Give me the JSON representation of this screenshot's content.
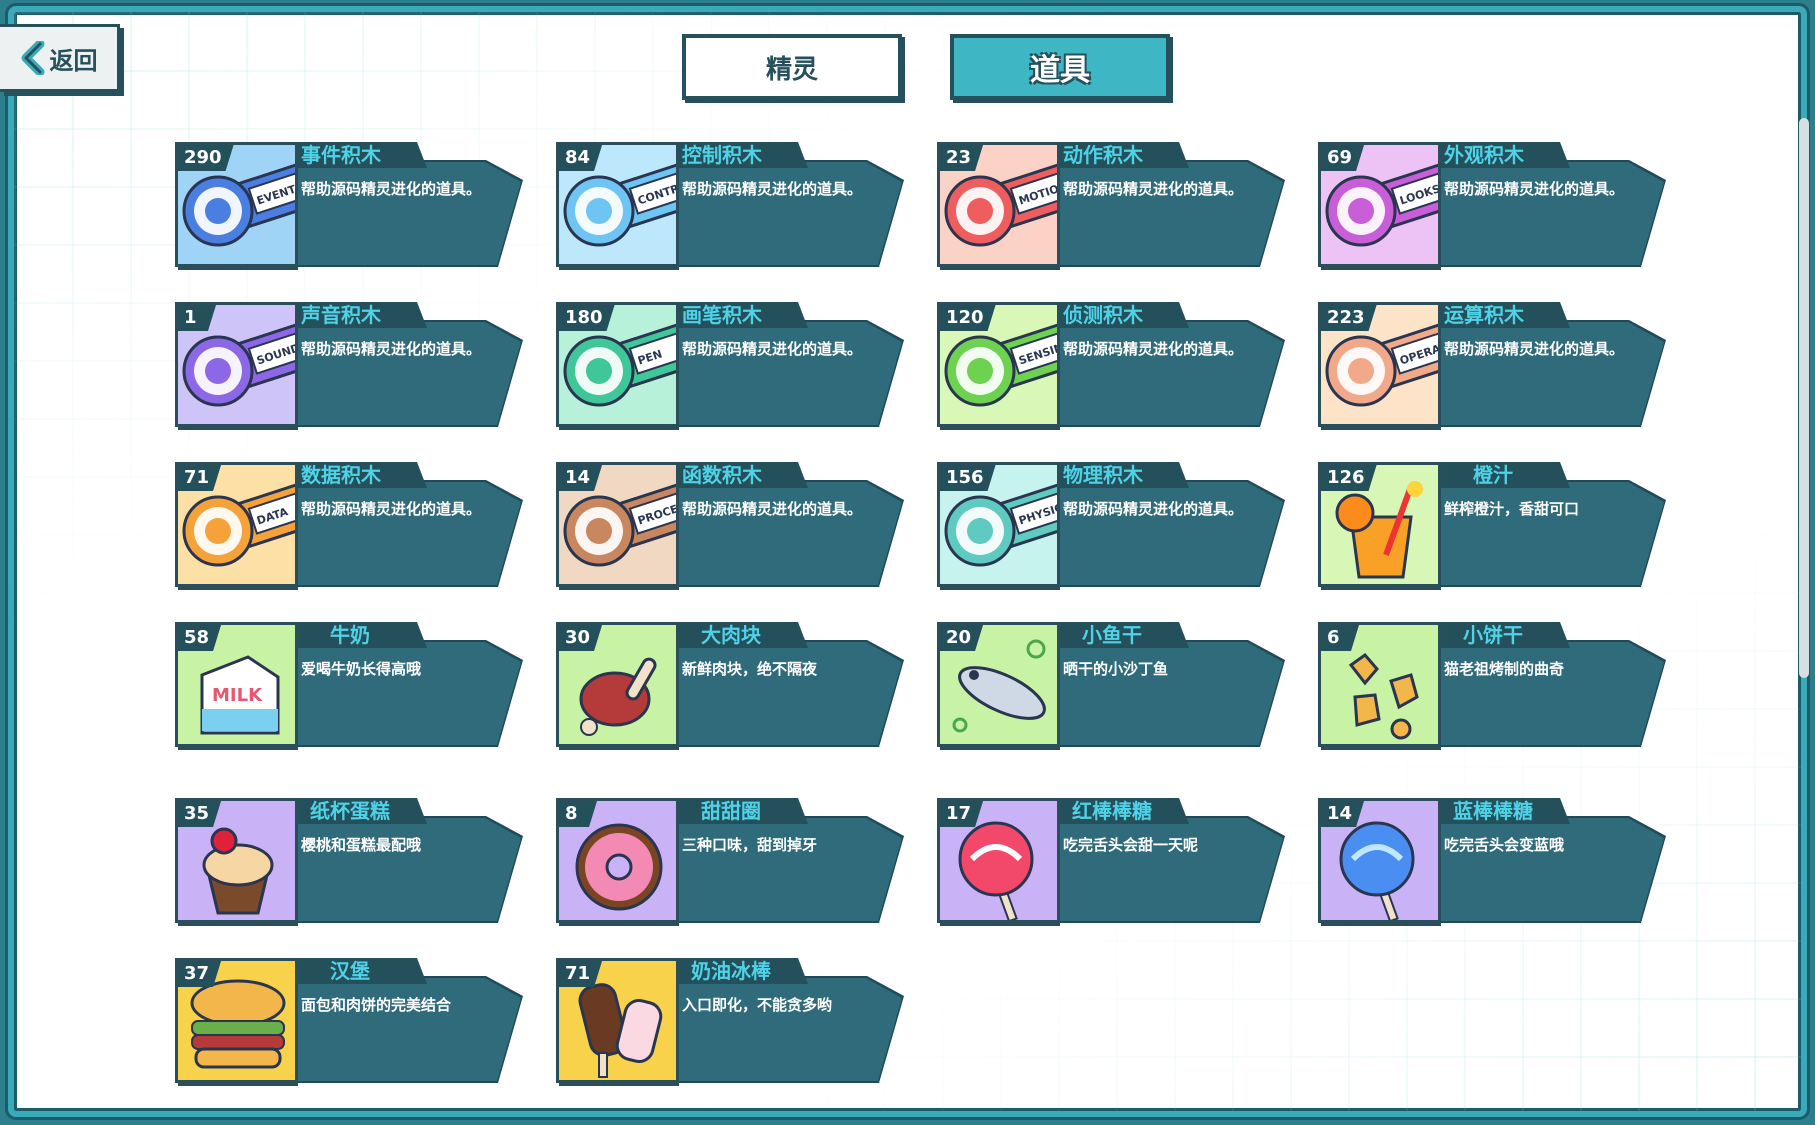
{
  "nav": {
    "back_label": "返回"
  },
  "tabs": {
    "sprite": "精灵",
    "items": "道具"
  },
  "colors": {
    "accent": "#3fb6c3",
    "panel": "#2f6b7a",
    "outline": "#26505b",
    "title_text": "#4fd2e6"
  },
  "items": [
    {
      "count": "290",
      "name": "事件积木",
      "desc": "帮助源码精灵进化的道具。",
      "bg": "#9fd4f6",
      "key": "#4a7ee0",
      "icon": "toggle-icon",
      "tag": "EVENTS"
    },
    {
      "count": "84",
      "name": "控制积木",
      "desc": "帮助源码精灵进化的道具。",
      "bg": "#bde7fb",
      "key": "#6ec4f2",
      "icon": "gamepad-icon",
      "tag": "CONTRO"
    },
    {
      "count": "23",
      "name": "动作积木",
      "desc": "帮助源码精灵进化的道具。",
      "bg": "#fcd2c6",
      "key": "#ef5e5e",
      "icon": "ghost-icon",
      "tag": "MOTION"
    },
    {
      "count": "69",
      "name": "外观积木",
      "desc": "帮助源码精灵进化的道具。",
      "bg": "#ecc3f4",
      "key": "#c85fd8",
      "icon": "shirt-icon",
      "tag": "LOOKS"
    },
    {
      "count": "1",
      "name": "声音积木",
      "desc": "帮助源码精灵进化的道具。",
      "bg": "#cfc4f8",
      "key": "#8c68e6",
      "icon": "microphone-icon",
      "tag": "SOUND"
    },
    {
      "count": "180",
      "name": "画笔积木",
      "desc": "帮助源码精灵进化的道具。",
      "bg": "#b7f1da",
      "key": "#3fc79a",
      "icon": "pen-icon",
      "tag": "PEN"
    },
    {
      "count": "120",
      "name": "侦测积木",
      "desc": "帮助源码精灵进化的道具。",
      "bg": "#d9f7b7",
      "key": "#6cd24f",
      "icon": "target-icon",
      "tag": "SENSING"
    },
    {
      "count": "223",
      "name": "运算积木",
      "desc": "帮助源码精灵进化的道具。",
      "bg": "#fde3c8",
      "key": "#f2a98a",
      "icon": "calculator-icon",
      "tag": "OPERATO"
    },
    {
      "count": "71",
      "name": "数据积木",
      "desc": "帮助源码精灵进化的道具。",
      "bg": "#fde0a6",
      "key": "#f6a23a",
      "icon": "bar-chart-icon",
      "tag": "DATA"
    },
    {
      "count": "14",
      "name": "函数积木",
      "desc": "帮助源码精灵进化的道具。",
      "bg": "#f1d8c3",
      "key": "#c9875f",
      "icon": "function-icon",
      "tag": "PROCED"
    },
    {
      "count": "156",
      "name": "物理积木",
      "desc": "帮助源码精灵进化的道具。",
      "bg": "#c7f3ee",
      "key": "#5fcbc0",
      "icon": "magnet-icon",
      "tag": "PHYSICS"
    },
    {
      "count": "126",
      "name": "橙汁",
      "desc": "鲜榨橙汁，香甜可口",
      "bg": "#d8f6b6",
      "icon": "orange-juice-icon",
      "food": true
    },
    {
      "count": "58",
      "name": "牛奶",
      "desc": "爱喝牛奶长得高哦",
      "bg": "#c8f2a4",
      "icon": "milk-carton-icon",
      "food": true
    },
    {
      "count": "30",
      "name": "大肉块",
      "desc": "新鲜肉块，绝不隔夜",
      "bg": "#c8f2a4",
      "icon": "meat-icon",
      "food": true
    },
    {
      "count": "20",
      "name": "小鱼干",
      "desc": "晒干的小沙丁鱼",
      "bg": "#c8f2a4",
      "icon": "fish-icon",
      "food": true
    },
    {
      "count": "6",
      "name": "小饼干",
      "desc": "猫老祖烤制的曲奇",
      "bg": "#c8f2a4",
      "icon": "cookie-icon",
      "food": true
    },
    {
      "count": "35",
      "name": "纸杯蛋糕",
      "desc": "樱桃和蛋糕最配哦",
      "bg": "#c9b3f6",
      "icon": "cupcake-icon",
      "food": true
    },
    {
      "count": "8",
      "name": "甜甜圈",
      "desc": "三种口味，甜到掉牙",
      "bg": "#c9b3f6",
      "icon": "donut-icon",
      "food": true
    },
    {
      "count": "17",
      "name": "红棒棒糖",
      "desc": "吃完舌头会甜一天呢",
      "bg": "#c9b3f6",
      "icon": "red-lollipop-icon",
      "food": true
    },
    {
      "count": "14",
      "name": "蓝棒棒糖",
      "desc": "吃完舌头会变蓝哦",
      "bg": "#c9b3f6",
      "icon": "blue-lollipop-icon",
      "food": true
    },
    {
      "count": "37",
      "name": "汉堡",
      "desc": "面包和肉饼的完美结合",
      "bg": "#f7d24a",
      "icon": "burger-icon",
      "food": true
    },
    {
      "count": "71",
      "name": "奶油冰棒",
      "desc": "入口即化，不能贪多哟",
      "bg": "#f7d24a",
      "icon": "ice-cream-bar-icon",
      "food": true
    }
  ]
}
